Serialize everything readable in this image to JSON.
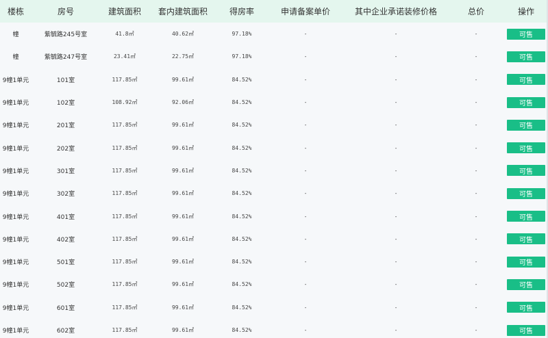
{
  "columns": [
    "楼栋",
    "房号",
    "建筑面积",
    "套内建筑面积",
    "得房率",
    "申请备案单价",
    "其中企业承诺装修价格",
    "总价",
    "操作"
  ],
  "rows": [
    {
      "building": "幢",
      "room": "紫毓路245号室",
      "area": "41.8㎡",
      "inner_area": "40.62㎡",
      "ratio": "97.18%",
      "unit_price": "-",
      "decor_price": "-",
      "total": "-",
      "status": "可售"
    },
    {
      "building": "幢",
      "room": "紫毓路247号室",
      "area": "23.41㎡",
      "inner_area": "22.75㎡",
      "ratio": "97.18%",
      "unit_price": "-",
      "decor_price": "-",
      "total": "-",
      "status": "可售"
    },
    {
      "building": "9幢1单元",
      "room": "101室",
      "area": "117.85㎡",
      "inner_area": "99.61㎡",
      "ratio": "84.52%",
      "unit_price": "-",
      "decor_price": "-",
      "total": "-",
      "status": "可售"
    },
    {
      "building": "9幢1单元",
      "room": "102室",
      "area": "108.92㎡",
      "inner_area": "92.06㎡",
      "ratio": "84.52%",
      "unit_price": "-",
      "decor_price": "-",
      "total": "-",
      "status": "可售"
    },
    {
      "building": "9幢1单元",
      "room": "201室",
      "area": "117.85㎡",
      "inner_area": "99.61㎡",
      "ratio": "84.52%",
      "unit_price": "-",
      "decor_price": "-",
      "total": "-",
      "status": "可售"
    },
    {
      "building": "9幢1单元",
      "room": "202室",
      "area": "117.85㎡",
      "inner_area": "99.61㎡",
      "ratio": "84.52%",
      "unit_price": "-",
      "decor_price": "-",
      "total": "-",
      "status": "可售"
    },
    {
      "building": "9幢1单元",
      "room": "301室",
      "area": "117.85㎡",
      "inner_area": "99.61㎡",
      "ratio": "84.52%",
      "unit_price": "-",
      "decor_price": "-",
      "total": "-",
      "status": "可售"
    },
    {
      "building": "9幢1单元",
      "room": "302室",
      "area": "117.85㎡",
      "inner_area": "99.61㎡",
      "ratio": "84.52%",
      "unit_price": "-",
      "decor_price": "-",
      "total": "-",
      "status": "可售"
    },
    {
      "building": "9幢1单元",
      "room": "401室",
      "area": "117.85㎡",
      "inner_area": "99.61㎡",
      "ratio": "84.52%",
      "unit_price": "-",
      "decor_price": "-",
      "total": "-",
      "status": "可售"
    },
    {
      "building": "9幢1单元",
      "room": "402室",
      "area": "117.85㎡",
      "inner_area": "99.61㎡",
      "ratio": "84.52%",
      "unit_price": "-",
      "decor_price": "-",
      "total": "-",
      "status": "可售"
    },
    {
      "building": "9幢1单元",
      "room": "501室",
      "area": "117.85㎡",
      "inner_area": "99.61㎡",
      "ratio": "84.52%",
      "unit_price": "-",
      "decor_price": "-",
      "total": "-",
      "status": "可售"
    },
    {
      "building": "9幢1单元",
      "room": "502室",
      "area": "117.85㎡",
      "inner_area": "99.61㎡",
      "ratio": "84.52%",
      "unit_price": "-",
      "decor_price": "-",
      "total": "-",
      "status": "可售"
    },
    {
      "building": "9幢1单元",
      "room": "601室",
      "area": "117.85㎡",
      "inner_area": "99.61㎡",
      "ratio": "84.52%",
      "unit_price": "-",
      "decor_price": "-",
      "total": "-",
      "status": "可售"
    },
    {
      "building": "9幢1单元",
      "room": "602室",
      "area": "117.85㎡",
      "inner_area": "99.61㎡",
      "ratio": "84.52%",
      "unit_price": "-",
      "decor_price": "-",
      "total": "-",
      "status": "可售"
    }
  ]
}
